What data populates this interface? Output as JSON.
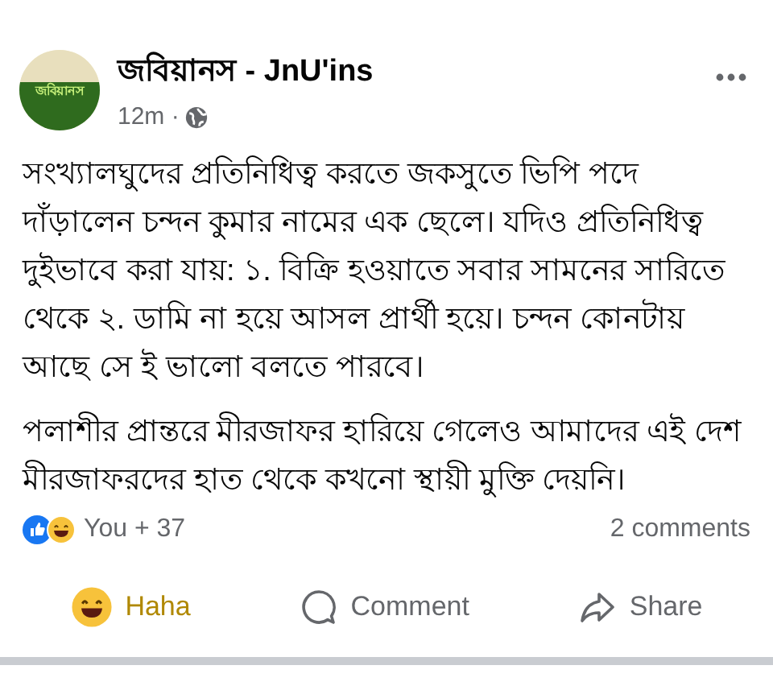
{
  "post": {
    "author": "জবিয়ানস - JnU'ins",
    "avatar_text": "জবিয়ানস",
    "time": "12m ·",
    "paragraphs": [
      "সংখ্যালঘুদের প্রতিনিধিত্ব করতে জকসুতে ভিপি পদে দাঁড়ালেন চন্দন কুমার নামের এক ছেলে। যদিও প্রতিনিধিত্ব দুইভাবে করা যায়: ১. বিক্রি হওয়াতে সবার সামনের সারিতে থেকে ২. ডামি না হয়ে আসল প্রার্থী হয়ে। চন্দন কোনটায় আছে সে ই ভালো বলতে পারবে।",
      "পলাশীর প্রান্তরে মীরজাফর হারিয়ে গেলেও আমাদের এই দেশ মীরজাফরদের হাত থেকে কখনো স্থায়ী মুক্তি দেয়নি।"
    ],
    "reactions_summary": "You + 37",
    "comments_count": "2 comments",
    "actions": [
      {
        "kind": "haha",
        "label": "Haha",
        "selected": true
      },
      {
        "kind": "comment",
        "label": "Comment",
        "selected": false
      },
      {
        "kind": "share",
        "label": "Share",
        "selected": false
      }
    ]
  }
}
